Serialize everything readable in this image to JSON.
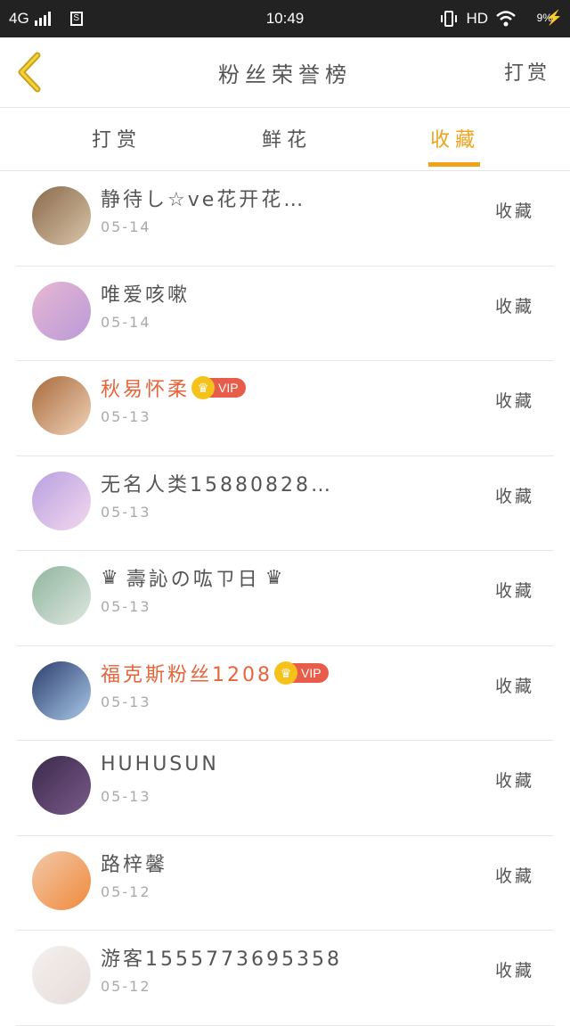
{
  "status_bar": {
    "network": "4G",
    "sim": "S",
    "time": "10:49",
    "hd": "HD",
    "battery": "9%",
    "colors": {
      "background": "#222222",
      "charge": "#f5b21b"
    }
  },
  "header": {
    "title": "粉丝荣誉榜",
    "right_action": "打赏",
    "back_icon": "chevron-left-icon",
    "back_color": "#c8a21a"
  },
  "tabs": [
    {
      "label": "打赏",
      "active": false
    },
    {
      "label": "鲜花",
      "active": false
    },
    {
      "label": "收藏",
      "active": true
    }
  ],
  "accent_color": "#f0a21b",
  "vip_color": "#e8643b",
  "list": [
    {
      "name": "静待し☆ve花开花…",
      "date": "05-14",
      "vip": false,
      "action": "收藏",
      "avatar_colors": [
        "#8a6a4c",
        "#d9c4a8"
      ]
    },
    {
      "name": "唯爱咳嗽",
      "date": "05-14",
      "vip": false,
      "action": "收藏",
      "avatar_colors": [
        "#e8b7d3",
        "#b99ad8"
      ]
    },
    {
      "name": "秋易怀柔",
      "date": "05-13",
      "vip": true,
      "vip_label": "VIP",
      "action": "收藏",
      "avatar_colors": [
        "#a86a3c",
        "#f0d2b8"
      ]
    },
    {
      "name": "无名人类15880828…",
      "date": "05-13",
      "vip": false,
      "action": "收藏",
      "avatar_colors": [
        "#b8a0e0",
        "#f3d8ef"
      ]
    },
    {
      "name": "壽訫の吰ㄗ日",
      "date": "05-13",
      "vip": false,
      "crown": true,
      "action": "收藏",
      "avatar_colors": [
        "#8fb59e",
        "#dfe7df"
      ]
    },
    {
      "name": "福克斯粉丝1208",
      "date": "05-13",
      "vip": true,
      "vip_label": "VIP",
      "action": "收藏",
      "avatar_colors": [
        "#2c3e6e",
        "#a9c8e8"
      ]
    },
    {
      "name": "HUHUSUN",
      "date": "05-13",
      "vip": false,
      "action": "收藏",
      "avatar_colors": [
        "#3a2a4a",
        "#7a5a8a"
      ]
    },
    {
      "name": "路梓馨",
      "date": "05-12",
      "vip": false,
      "action": "收藏",
      "avatar_colors": [
        "#f2c8a8",
        "#f08a3c"
      ]
    },
    {
      "name": "游客1555773695358",
      "date": "05-12",
      "vip": false,
      "action": "收藏",
      "avatar_colors": [
        "#f4f0ee",
        "#e6dcd8"
      ]
    }
  ]
}
